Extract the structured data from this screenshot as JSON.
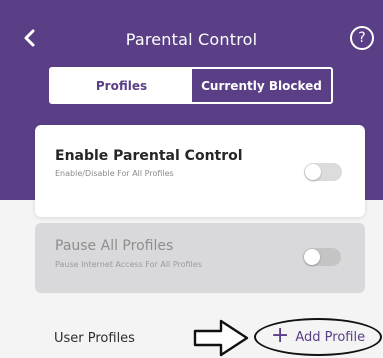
{
  "header": {
    "title": "Parental Control",
    "back_icon": "chevron-left-icon",
    "help_icon": "question-circle-icon",
    "help_glyph": "?",
    "background": "#5a3f86"
  },
  "tabs": [
    {
      "label": "Profiles",
      "selected": true
    },
    {
      "label": "Currently Blocked",
      "selected": false
    }
  ],
  "cards": {
    "enable": {
      "title": "Enable Parental Control",
      "subtitle": "Enable/Disable For All Profiles",
      "toggle_on": false
    },
    "pause": {
      "title": "Pause All Profiles",
      "subtitle": "Pause Internet Access For All Profiles",
      "toggle_on": false,
      "disabled": true
    }
  },
  "user_profiles": {
    "label": "User Profiles",
    "add_button": {
      "plus": "+",
      "label": "Add Profile"
    },
    "annotation_icon": "right-arrow-outline-icon"
  }
}
